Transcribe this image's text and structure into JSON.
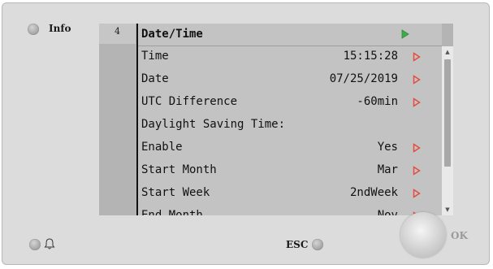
{
  "panel": {
    "info_label": "Info",
    "esc_label": "ESC",
    "ok_label": "OK",
    "bell_icon": "bell-icon"
  },
  "screen": {
    "line_number": "4",
    "title": "Date/Time",
    "rows": [
      {
        "label": "Time",
        "value": "15:15:28",
        "arrow": true
      },
      {
        "label": "Date",
        "value": "07/25/2019",
        "arrow": true
      },
      {
        "label": "UTC Difference",
        "value": "-60min",
        "arrow": true
      },
      {
        "label": "Daylight Saving Time:",
        "value": "",
        "arrow": false
      },
      {
        "label": "Enable",
        "value": "Yes",
        "arrow": true
      },
      {
        "label": "Start Month",
        "value": "Mar",
        "arrow": true
      },
      {
        "label": "Start Week",
        "value": "2ndWeek",
        "arrow": true
      },
      {
        "label": "End Month",
        "value": "Nov",
        "arrow": true
      }
    ]
  },
  "colors": {
    "title_arrow": "#3cb043",
    "row_arrow": "#e8473c"
  }
}
